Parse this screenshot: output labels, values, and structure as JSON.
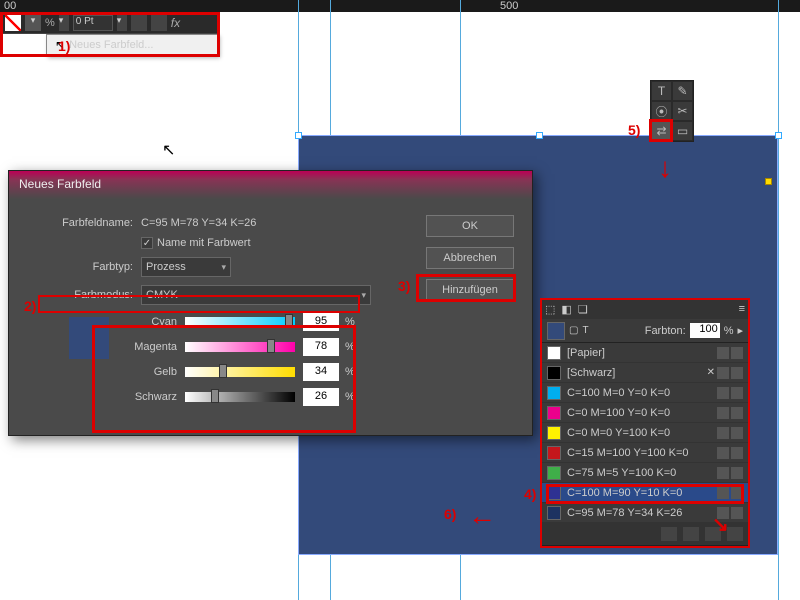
{
  "ruler": {
    "mark0": "00",
    "mark500": "500"
  },
  "toolbar": {
    "stroke_value": "0 Pt",
    "fx": "fx"
  },
  "menu_popup": {
    "label": "Neues Farbfeld..."
  },
  "annotations": {
    "a1": "1)",
    "a2": "2)",
    "a3": "3)",
    "a4": "4)",
    "a5": "5)",
    "a6": "6)"
  },
  "dialog": {
    "title": "Neues Farbfeld",
    "name_label": "Farbfeldname:",
    "name_value": "C=95 M=78 Y=34 K=26",
    "check_label": "Name mit Farbwert",
    "type_label": "Farbtyp:",
    "type_value": "Prozess",
    "mode_label": "Farbmodus:",
    "mode_value": "CMYK",
    "btn_ok": "OK",
    "btn_cancel": "Abbrechen",
    "btn_add": "Hinzufügen",
    "sliders": {
      "cyan": {
        "label": "Cyan",
        "value": "95",
        "pct": "%"
      },
      "mag": {
        "label": "Magenta",
        "value": "78",
        "pct": "%"
      },
      "yel": {
        "label": "Gelb",
        "value": "34",
        "pct": "%"
      },
      "blk": {
        "label": "Schwarz",
        "value": "26",
        "pct": "%"
      }
    }
  },
  "mini_tools": {
    "t": "T",
    "pencil": "✎",
    "eyedrop": "⦿",
    "scissors": "✂",
    "swap": "⇄",
    "grad": "▭"
  },
  "swatches": {
    "tint_label": "Farbton:",
    "tint_value": "100",
    "tint_pct": "%",
    "items": [
      {
        "name": "[Papier]",
        "color": "#ffffff"
      },
      {
        "name": "[Schwarz]",
        "color": "#000000",
        "lock": true
      },
      {
        "name": "C=100 M=0 Y=0 K=0",
        "color": "#00aeef"
      },
      {
        "name": "C=0 M=100 Y=0 K=0",
        "color": "#ec008c"
      },
      {
        "name": "C=0 M=0 Y=100 K=0",
        "color": "#fff200"
      },
      {
        "name": "C=15 M=100 Y=100 K=0",
        "color": "#c4161c"
      },
      {
        "name": "C=75 M=5 Y=100 K=0",
        "color": "#3fae49"
      },
      {
        "name": "C=100 M=90 Y=10 K=0",
        "color": "#2e3192",
        "selected": true
      },
      {
        "name": "C=95 M=78 Y=34 K=26",
        "color": "#1d3261"
      }
    ]
  }
}
